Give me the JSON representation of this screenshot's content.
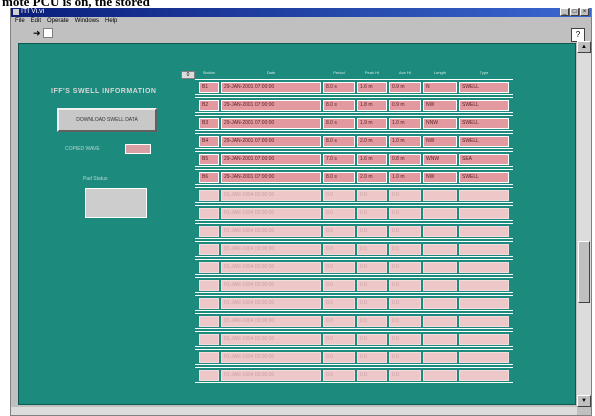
{
  "caption": "mote PCU is on, the stored",
  "window": {
    "title": "ITI Vi.vi",
    "menu": [
      "File",
      "Edit",
      "Operate",
      "Windows",
      "Help"
    ],
    "run_glyph": "➜",
    "help_glyph": "?",
    "minimize_glyph": "_",
    "maximize_glyph": "□",
    "close_glyph": "×",
    "scroll_up": "▲",
    "scroll_down": "▼"
  },
  "panel": {
    "heading": "IFF'S SWELL INFORMATION",
    "download_button": "DOWNLOAD SWELL DATA",
    "copied_label": "COPIED WAVE",
    "pad_label": "Pad Status",
    "row_indicator": "0"
  },
  "grid": {
    "headers": [
      "Station",
      "Date",
      "Period",
      "Peak Ht",
      "Ave Ht",
      "Length",
      "Type"
    ],
    "filled_rows": [
      [
        "B1",
        "29-JAN-2001 07:00:00",
        "8.0 s",
        "1.6 m",
        "0.9 m",
        "N",
        "SWELL"
      ],
      [
        "B2",
        "29-JAN-2001 07:00:00",
        "8.0 s",
        "1.8 m",
        "0.9 m",
        "NW",
        "SWELL"
      ],
      [
        "B3",
        "29-JAN-2001 07:00:00",
        "8.0 s",
        "1.9 m",
        "1.0 m",
        "NNW",
        "SWELL"
      ],
      [
        "B4",
        "29-JAN-2001 07:00:00",
        "8.0 s",
        "2.0 m",
        "1.0 m",
        "NW",
        "SWELL"
      ],
      [
        "B5",
        "29-JAN-2001 07:00:00",
        "7.0 s",
        "1.6 m",
        "0.8 m",
        "WNW",
        "SEA"
      ],
      [
        "B6",
        "29-JAN-2001 07:00:00",
        "8.0 s",
        "2.0 m",
        "1.0 m",
        "NW",
        "SWELL"
      ]
    ],
    "empty_rows": [
      [
        "",
        "01-JAN-1904 00:00:00",
        "0.0",
        "0.0",
        "0.0",
        "",
        ""
      ],
      [
        "",
        "01-JAN-1904 00:00:00",
        "0.0",
        "0.0",
        "0.0",
        "",
        ""
      ],
      [
        "",
        "01-JAN-1904 00:00:00",
        "0.0",
        "0.0",
        "0.0",
        "",
        ""
      ],
      [
        "",
        "01-JAN-1904 00:00:00",
        "0.0",
        "0.0",
        "0.0",
        "",
        ""
      ],
      [
        "",
        "01-JAN-1904 00:00:00",
        "0.0",
        "0.0",
        "0.0",
        "",
        ""
      ],
      [
        "",
        "01-JAN-1904 00:00:00",
        "0.0",
        "0.0",
        "0.0",
        "",
        ""
      ],
      [
        "",
        "01-JAN-1904 00:00:00",
        "0.0",
        "0.0",
        "0.0",
        "",
        ""
      ],
      [
        "",
        "01-JAN-1904 00:00:00",
        "0.0",
        "0.0",
        "0.0",
        "",
        ""
      ],
      [
        "",
        "01-JAN-1904 00:00:00",
        "0.0",
        "0.0",
        "0.0",
        "",
        ""
      ],
      [
        "",
        "01-JAN-1904 00:00:00",
        "0.0",
        "0.0",
        "0.0",
        "",
        ""
      ],
      [
        "",
        "01-JAN-1904 00:00:00",
        "0.0",
        "0.0",
        "0.0",
        "",
        ""
      ]
    ]
  }
}
